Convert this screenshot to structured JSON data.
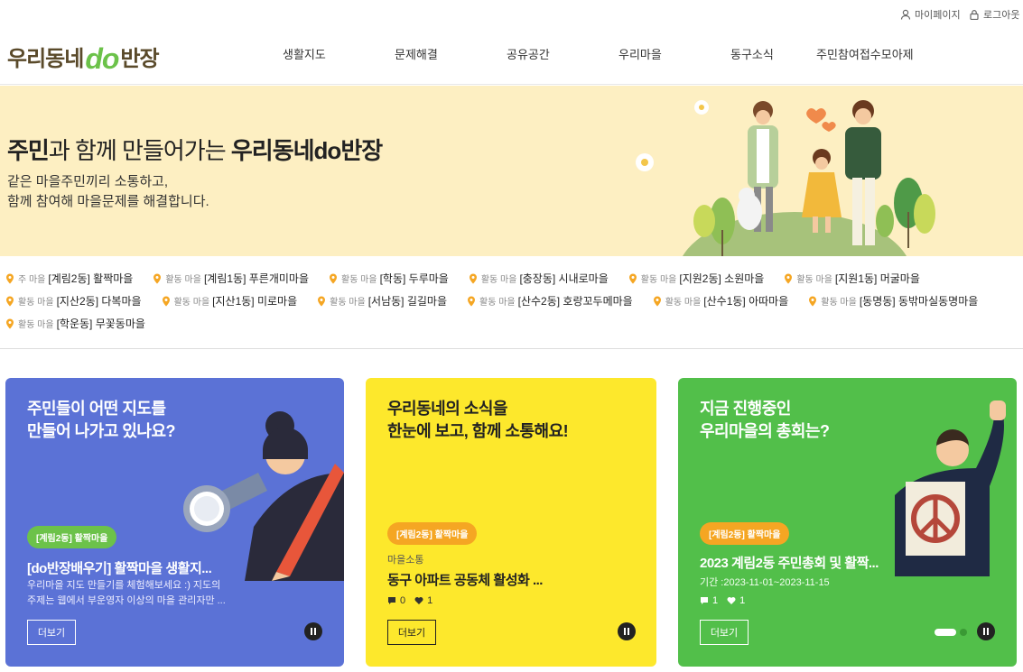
{
  "util": {
    "mypage": "마이페이지",
    "logout": "로그아웃"
  },
  "logo": {
    "part1": "우리동네",
    "part2": "do",
    "part3": "반장"
  },
  "nav": [
    "생활지도",
    "문제해결",
    "공유공간",
    "우리마을",
    "동구소식",
    "주민참여접수모아제"
  ],
  "hero": {
    "title_bold1": "주민",
    "title_mid": "과 함께 만들어가는 ",
    "title_bold2": "우리동네do반장",
    "sub1": "같은 마을주민끼리 소통하고,",
    "sub2": "함께 참여해 마을문제를 해결합니다."
  },
  "villages": [
    [
      {
        "pre": "주 마을",
        "name": "[계림2동] 활짝마을"
      },
      {
        "pre": "활동 마을",
        "name": "[계림1동] 푸른개미마을"
      },
      {
        "pre": "활동 마을",
        "name": "[학동] 두루마을"
      },
      {
        "pre": "활동 마을",
        "name": "[충장동] 시내로마을"
      },
      {
        "pre": "활동 마을",
        "name": "[지원2동] 소원마을"
      },
      {
        "pre": "활동 마을",
        "name": "[지원1동] 머굴마을"
      }
    ],
    [
      {
        "pre": "활동 마을",
        "name": "[지산2동] 다복마을"
      },
      {
        "pre": "활동 마을",
        "name": "[지산1동] 미로마을"
      },
      {
        "pre": "활동 마을",
        "name": "[서남동] 길길마을"
      },
      {
        "pre": "활동 마을",
        "name": "[산수2동] 호랑꼬두메마을"
      },
      {
        "pre": "활동 마을",
        "name": "[산수1동] 아따마을"
      },
      {
        "pre": "활동 마을",
        "name": "[동명동] 동밖마실동명마을"
      }
    ],
    [
      {
        "pre": "활동 마을",
        "name": "[학운동] 무꽃동마을"
      }
    ]
  ],
  "cards": [
    {
      "title1": "주민들이 어떤 지도를",
      "title2": "만들어 나가고 있나요?",
      "tag": "[계림2동] 활짝마을",
      "head": "[do반장배우기] 활짝마을 생활지...",
      "desc1": "우리마을 지도 만들기를 체험해보세요 :) 지도의",
      "desc2": "주제는 웹에서 부운영자 이상의 마을 관리자만 ...",
      "more": "더보기",
      "bg": "#5b72d6",
      "tag_color": "#6cc24a"
    },
    {
      "title1": "우리동네의 소식을",
      "title2": "한눈에 보고, 함께 소통해요!",
      "tag": "[계림2동] 활짝마을",
      "category": "마을소통",
      "head": "동구 아파트 공동체 활성화 ...",
      "comments": "0",
      "likes": "1",
      "more": "더보기",
      "bg": "#fde82c",
      "tag_color": "#f5a623"
    },
    {
      "title1": "지금 진행중인",
      "title2": "우리마을의 총회는?",
      "tag": "[계림2동] 활짝마을",
      "head": "2023 계림2동 주민총회 및 활짝...",
      "period": "기간 :2023-11-01~2023-11-15",
      "comments": "1",
      "likes": "1",
      "more": "더보기",
      "bg": "#52bf4a",
      "tag_color": "#f5a623"
    }
  ]
}
